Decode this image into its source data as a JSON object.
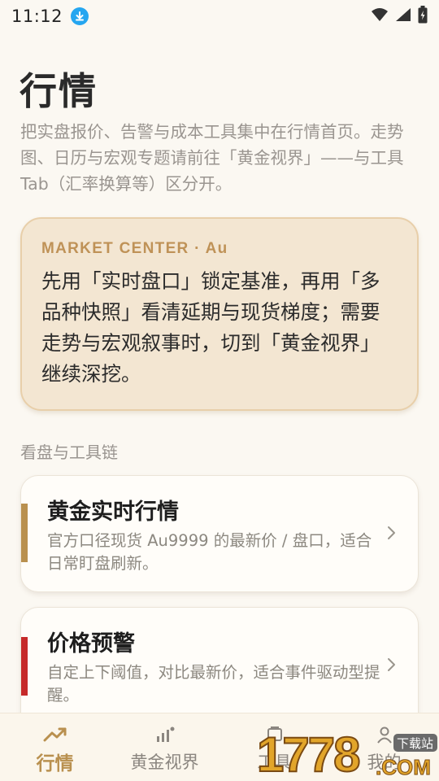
{
  "status_bar": {
    "time": "11:12",
    "download_icon": "download-badge-icon",
    "wifi_icon": "wifi-icon",
    "signal_icon": "cell-signal-icon",
    "battery_icon": "battery-charging-icon"
  },
  "header": {
    "title": "行情",
    "description": "把实盘报价、告警与成本工具集中在行情首页。走势图、日历与宏观专题请前往「黄金视界」——与工具 Tab（汇率换算等）区分开。"
  },
  "intro_card": {
    "kicker": "MARKET CENTER · Au",
    "text": "先用「实时盘口」锁定基准，再用「多品种快照」看清延期与现货梯度；需要走势与宏观叙事时，切到「黄金视界」继续深挖。"
  },
  "section": {
    "label": "看盘与工具链"
  },
  "cards": [
    {
      "title": "黄金实时行情",
      "description": "官方口径现货 Au9999 的最新价 / 盘口，适合日常盯盘刷新。",
      "accent_color": "#b9904f"
    },
    {
      "title": "价格预警",
      "description": "自定上下阈值，对比最新价，适合事件驱动型提醒。",
      "accent_color": "#c62a2a"
    }
  ],
  "bottom_nav": {
    "items": [
      {
        "label": "行情",
        "icon": "trending-up-icon",
        "active": true
      },
      {
        "label": "黄金视界",
        "icon": "bar-chart-icon",
        "active": false
      },
      {
        "label": "工具",
        "icon": "tools-icon",
        "active": false
      },
      {
        "label": "我的",
        "icon": "person-icon",
        "active": false
      }
    ]
  },
  "watermark": {
    "text": "1778.COM",
    "badge": "下载站"
  },
  "colors": {
    "accent_gold": "#b9904f",
    "alert_red": "#c62a2a",
    "background": "#fbf8f2",
    "card_highlight": "#f3e6d2"
  }
}
